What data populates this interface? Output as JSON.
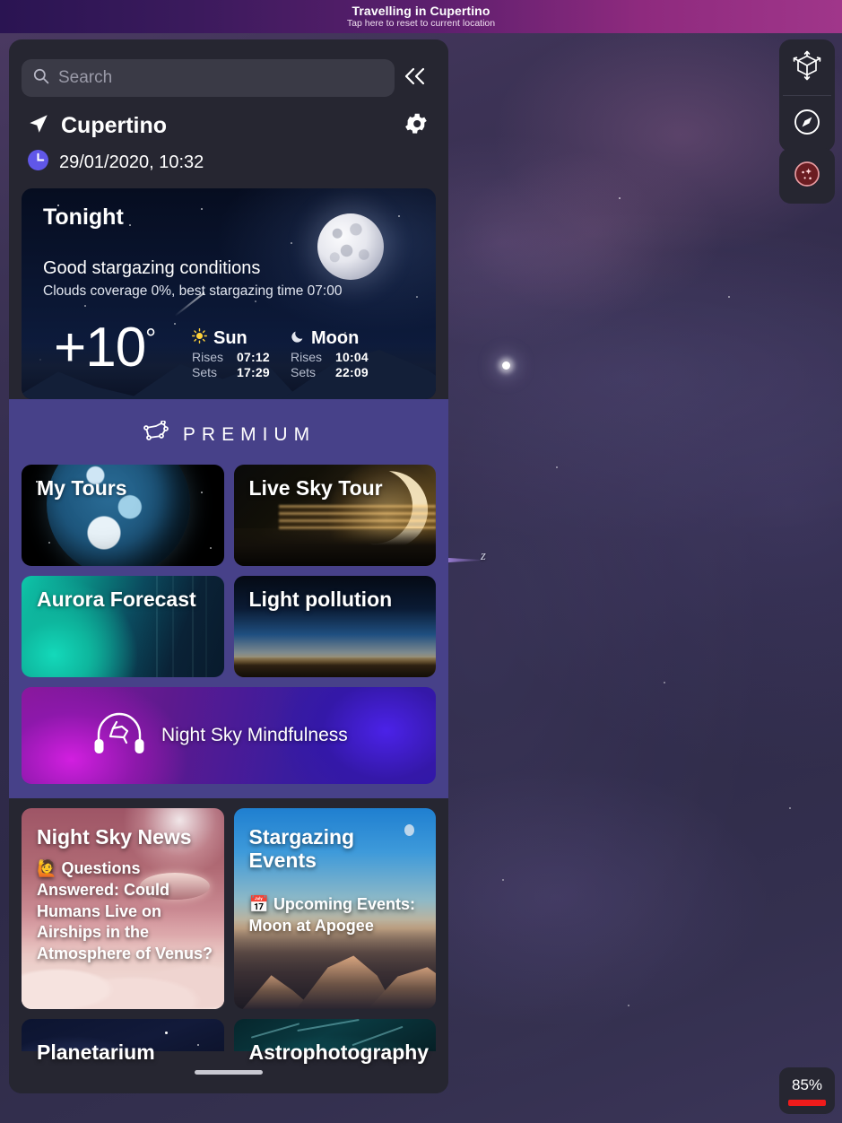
{
  "banner": {
    "title": "Travelling in Cupertino",
    "subtitle": "Tap here to reset to current location"
  },
  "sidebar": {
    "search": {
      "placeholder": "Search",
      "value": "",
      "icon": "search-icon"
    },
    "collapse_icon": "chevron-double-left-icon",
    "location": {
      "name": "Cupertino",
      "pin_icon": "navigation-arrow-icon",
      "settings_icon": "gear-icon",
      "clock_icon": "clock-icon",
      "datetime": "29/01/2020, 10:32"
    },
    "tonight": {
      "title": "Tonight",
      "condition": "Good stargazing conditions",
      "details": "Clouds coverage 0%, best stargazing time 07:00",
      "temperature": "+10",
      "degree_symbol": "°",
      "sun": {
        "name": "Sun",
        "icon": "sun-icon",
        "rises_label": "Rises",
        "rises_value": "07:12",
        "sets_label": "Sets",
        "sets_value": "17:29"
      },
      "moon": {
        "name": "Moon",
        "icon": "crescent-moon-icon",
        "rises_label": "Rises",
        "rises_value": "10:04",
        "sets_label": "Sets",
        "sets_value": "22:09"
      }
    },
    "premium": {
      "title": "PREMIUM",
      "logo_icon": "constellation-icon",
      "tiles": [
        {
          "label": "My Tours"
        },
        {
          "label": "Live Sky Tour"
        },
        {
          "label": "Aurora Forecast"
        },
        {
          "label": "Light pollution"
        }
      ],
      "mindfulness": {
        "label": "Night Sky Mindfulness",
        "icon": "headphones-constellation-icon"
      }
    },
    "news": [
      {
        "title": "Night Sky News",
        "emoji": "🙋",
        "description": "Questions Answered: Could Humans Live on Airships in the Atmosphere of Venus?"
      },
      {
        "title": "Stargazing Events",
        "emoji": "📅",
        "description": "Upcoming Events: Moon at Apogee"
      }
    ],
    "bottom_tiles": [
      {
        "label": "Planetarium"
      },
      {
        "label": "Astrophotography"
      }
    ]
  },
  "sky": {
    "axis_label_z": "z"
  },
  "controls": {
    "ar_icon": "ar-cube-icon",
    "compass_icon": "compass-icon",
    "night_mode_icon": "night-mode-icon"
  },
  "battery": {
    "level": "85%",
    "color": "#ef1b1b"
  },
  "colors": {
    "panel_bg": "#262631",
    "premium_bg": "#474189",
    "accent_purple": "#6057e8",
    "banner_from": "#2a1452",
    "banner_to": "#a0368a"
  }
}
